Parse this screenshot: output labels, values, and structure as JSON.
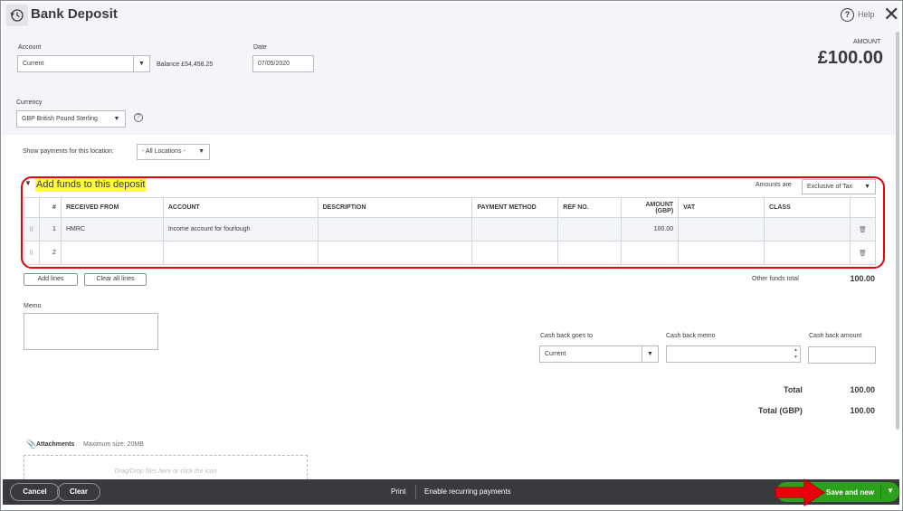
{
  "header": {
    "title": "Bank Deposit",
    "help_label": "Help",
    "amount_label": "AMOUNT",
    "amount_value": "£100.00"
  },
  "account": {
    "label": "Account",
    "value": "Current",
    "balance": "Balance £54,458.25"
  },
  "date": {
    "label": "Date",
    "value": "07/05/2020"
  },
  "currency": {
    "label": "Currency",
    "value": "GBP British Pound Sterling"
  },
  "location": {
    "label": "Show payments for this location:",
    "value": "- All Locations -"
  },
  "funds_section": {
    "title": "Add funds to this deposit",
    "amounts_are_label": "Amounts are",
    "amounts_are_value": "Exclusive of Tax",
    "columns": [
      "#",
      "RECEIVED FROM",
      "ACCOUNT",
      "DESCRIPTION",
      "PAYMENT METHOD",
      "REF NO.",
      "AMOUNT (GBP)",
      "VAT",
      "CLASS"
    ],
    "rows": [
      {
        "num": "1",
        "received_from": "HMRC",
        "account": "Income account for fourlough",
        "description": "",
        "payment_method": "",
        "ref_no": "",
        "amount": "100.00",
        "vat": "",
        "class": ""
      },
      {
        "num": "2",
        "received_from": "",
        "account": "",
        "description": "",
        "payment_method": "",
        "ref_no": "",
        "amount": "",
        "vat": "",
        "class": ""
      }
    ],
    "add_lines": "Add lines",
    "clear_all_lines": "Clear all lines",
    "other_funds_label": "Other funds total",
    "other_funds_value": "100.00"
  },
  "memo": {
    "label": "Memo"
  },
  "cash_back": {
    "goes_to_label": "Cash back goes to",
    "goes_to_value": "Current",
    "memo_label": "Cash back memo",
    "amount_label": "Cash back amount"
  },
  "totals": {
    "total_label": "Total",
    "total_value": "100.00",
    "total_gbp_label": "Total (GBP)",
    "total_gbp_value": "100.00"
  },
  "attachments": {
    "label": "Attachments",
    "max_size": "Maximum size: 20MB",
    "drop_text": "Drag/Drop files here or click the icon"
  },
  "footer": {
    "cancel": "Cancel",
    "clear": "Clear",
    "print": "Print",
    "recurring": "Enable recurring payments",
    "save_and_new": "Save and new"
  },
  "colors": {
    "highlight": "#ffff33",
    "annotation_red": "#e8000d",
    "save_green": "#2ca01c",
    "footer_dark": "#393a3d"
  },
  "icons": [
    "history-icon",
    "help-icon",
    "close-icon",
    "info-icon",
    "triangle-down-icon",
    "drag-handle-icon",
    "trash-icon",
    "paperclip-icon",
    "red-arrow-icon",
    "chevron-down-icon"
  ]
}
